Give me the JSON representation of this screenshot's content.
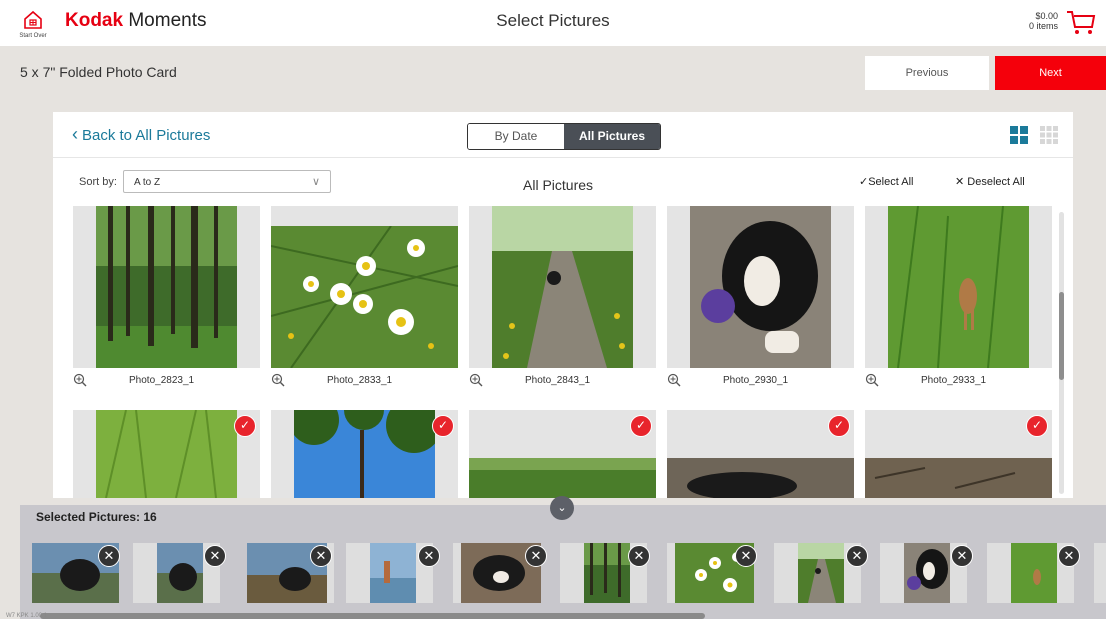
{
  "header": {
    "start_over": "Start Over",
    "brand_bold": "Kodak",
    "brand_rest": " Moments",
    "title": "Select Pictures",
    "cart_amount": "$0.00",
    "cart_items": "0 items"
  },
  "product": {
    "name": "5 x 7\" Folded Photo Card",
    "prev_label": "Previous",
    "next_label": "Next",
    "next_color": "#f5000b"
  },
  "panel": {
    "back_label": "Back to All Pictures",
    "tab_by_date": "By Date",
    "tab_all": "All Pictures",
    "active_tab": "All Pictures",
    "sort_label": "Sort by:",
    "sort_value": "A to Z",
    "title": "All Pictures",
    "select_all": "Select All",
    "deselect_all": "Deselect All"
  },
  "photos": [
    {
      "name": "Photo_2823_1",
      "selected": false,
      "scene": "forest"
    },
    {
      "name": "Photo_2833_1",
      "selected": false,
      "scene": "daisies"
    },
    {
      "name": "Photo_2843_1",
      "selected": false,
      "scene": "path"
    },
    {
      "name": "Photo_2930_1",
      "selected": false,
      "scene": "dog"
    },
    {
      "name": "Photo_2933_1",
      "selected": false,
      "scene": "deer"
    },
    {
      "name": "",
      "selected": true,
      "scene": "grass"
    },
    {
      "name": "",
      "selected": true,
      "scene": "trees-sky"
    },
    {
      "name": "",
      "selected": true,
      "scene": "landscape"
    },
    {
      "name": "",
      "selected": true,
      "scene": "dog-lying"
    },
    {
      "name": "",
      "selected": true,
      "scene": "ground"
    }
  ],
  "tray": {
    "title": "Selected Pictures: 16",
    "count": 16,
    "thumbs": [
      "lake-dog",
      "lake-dog",
      "lake-dog",
      "lake-person",
      "dog-lying",
      "forest",
      "daisies",
      "path",
      "dog",
      "deer"
    ]
  },
  "footer": {
    "version": "W7  KPK 1.00.1"
  },
  "colors": {
    "accent_red": "#e8242c",
    "link_blue": "#1b7a9a"
  }
}
